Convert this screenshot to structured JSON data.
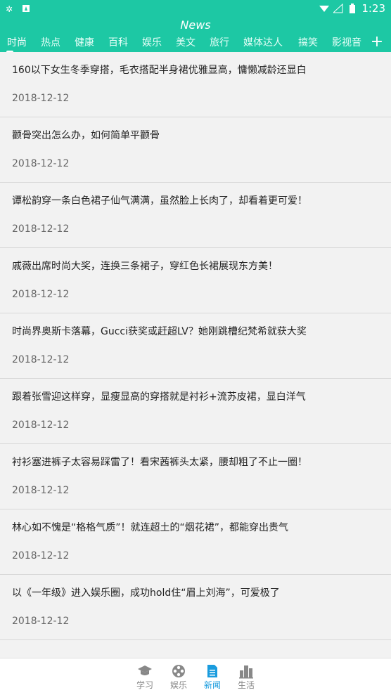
{
  "status_bar": {
    "time": "1:23"
  },
  "header": {
    "title": "News",
    "tabs": [
      {
        "label": "时尚"
      },
      {
        "label": "热点"
      },
      {
        "label": "健康"
      },
      {
        "label": "百科"
      },
      {
        "label": "娱乐"
      },
      {
        "label": "美文"
      },
      {
        "label": "旅行"
      },
      {
        "label": "媒体达人"
      },
      {
        "label": "搞笑"
      },
      {
        "label": "影视音"
      }
    ],
    "add_label": "+"
  },
  "news": [
    {
      "title": "160以下女生冬季穿搭，毛衣搭配半身裙优雅显高，慵懒减龄还显白",
      "date": "2018-12-12"
    },
    {
      "title": "颧骨突出怎么办，如何简单平颧骨",
      "date": "2018-12-12"
    },
    {
      "title": "谭松韵穿一条白色裙子仙气满满，虽然脸上长肉了，却看着更可爱！",
      "date": "2018-12-12"
    },
    {
      "title": "戚薇出席时尚大奖，连换三条裙子，穿红色长裙展现东方美！",
      "date": "2018-12-12"
    },
    {
      "title": "时尚界奥斯卡落幕，Gucci获奖或赶超LV？她刚跳槽纪梵希就获大奖",
      "date": "2018-12-12"
    },
    {
      "title": "跟着张雪迎这样穿，显瘦显高的穿搭就是衬衫+流苏皮裙，显白洋气",
      "date": "2018-12-12"
    },
    {
      "title": "衬衫塞进裤子太容易踩雷了！看宋茜裤头太紧，腰却粗了不止一圈！",
      "date": "2018-12-12"
    },
    {
      "title": "林心如不愧是“格格气质”！就连超土的“烟花裙”，都能穿出贵气",
      "date": "2018-12-12"
    },
    {
      "title": "以《一年级》进入娱乐圈，成功hold住“眉上刘海”，可爱极了",
      "date": "2018-12-12"
    }
  ],
  "bottom_nav": [
    {
      "label": "学习",
      "icon": "graduation-cap-icon"
    },
    {
      "label": "娱乐",
      "icon": "film-reel-icon"
    },
    {
      "label": "新闻",
      "icon": "document-icon"
    },
    {
      "label": "生活",
      "icon": "city-icon"
    }
  ],
  "colors": {
    "accent": "#1dc8a4",
    "nav_active": "#1a9cde"
  }
}
